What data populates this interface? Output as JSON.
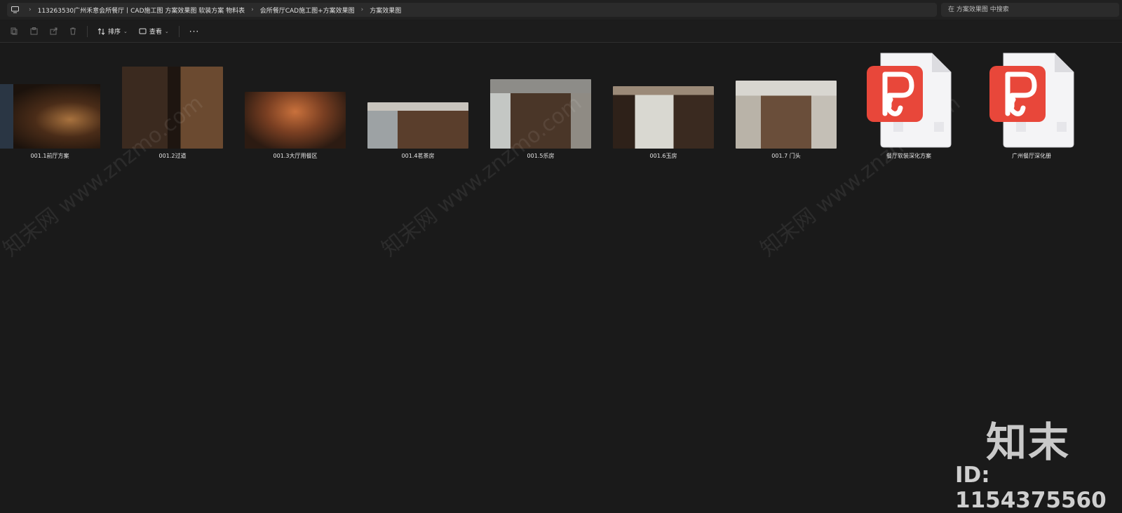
{
  "breadcrumb": [
    "113263530广州禾意会所餐厅丨CAD施工图 方案效果图 软装方案 物料表",
    "会所餐厅CAD施工图+方案效果图",
    "方案效果图"
  ],
  "search": {
    "placeholder": "在 方案效果图 中搜索"
  },
  "toolbar": {
    "sort_label": "排序",
    "view_label": "查看",
    "more_label": "···"
  },
  "files": [
    {
      "name": "001.1前厅方案",
      "type": "image"
    },
    {
      "name": "001.2过道",
      "type": "image"
    },
    {
      "name": "001.3大厅用餐区",
      "type": "image"
    },
    {
      "name": "001.4茗茶房",
      "type": "image"
    },
    {
      "name": "001.5乐房",
      "type": "image"
    },
    {
      "name": "001.6玉房",
      "type": "image"
    },
    {
      "name": "001.7 门头",
      "type": "image"
    },
    {
      "name": "餐厅软装深化方案",
      "type": "pdf"
    },
    {
      "name": "广州餐厅深化册",
      "type": "pdf"
    }
  ],
  "watermark": {
    "brand": "知末",
    "id": "ID: 1154375560",
    "diagonal": "知末网 www.znzmo.com"
  },
  "colors": {
    "pdf_red": "#e8473a",
    "background": "#1a1a1a"
  }
}
